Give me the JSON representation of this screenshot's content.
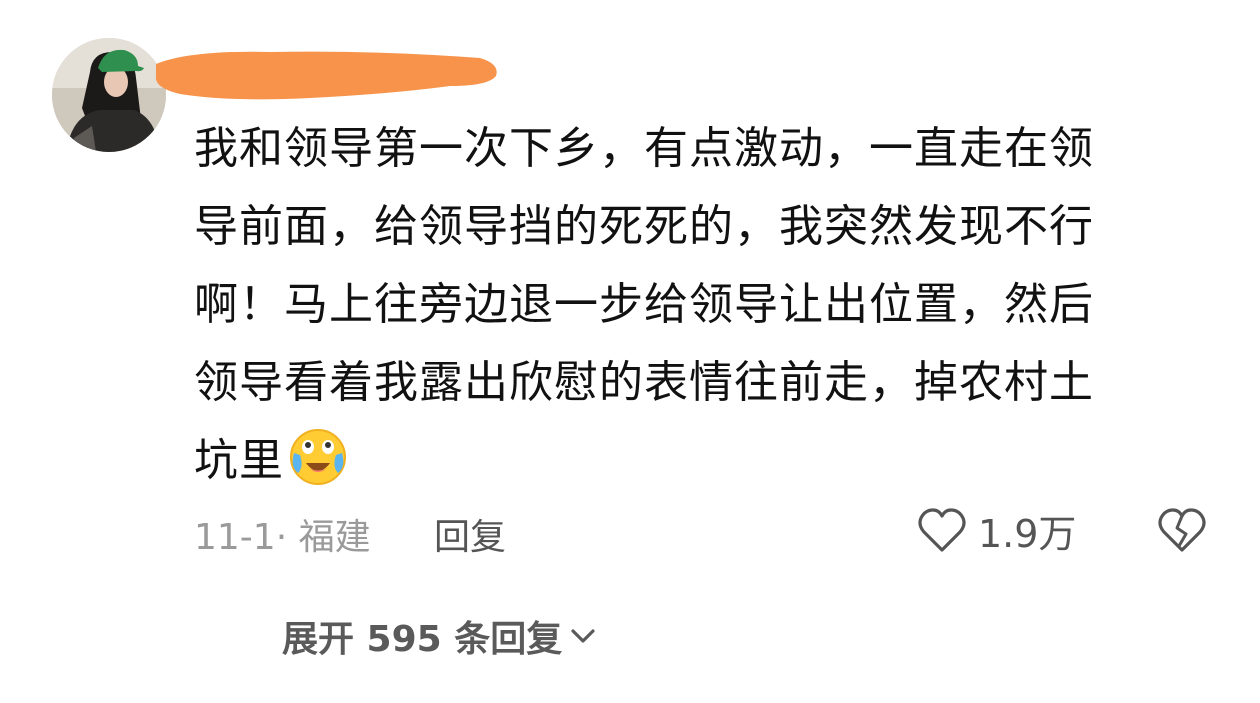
{
  "comment": {
    "avatar_icon": "user-avatar",
    "username_redaction_color": "#f7934a",
    "lines": [
      "我和领导第一次下乡，有点激动，一直走在领",
      "导前面，给领导挡的死死的，我突然发现不行",
      "啊！马上往旁边退一步给领导让出位置，然后",
      "领导看着我露出欣慰的表情往前走，掉农村土",
      "坑里"
    ],
    "emoji_icon": "laughing-crying-emoji",
    "date_location": "11-1· 福建",
    "reply_label": "回复",
    "like_icon": "heart-outline-icon",
    "like_count": "1.9万",
    "dislike_icon": "broken-heart-icon"
  },
  "replies": {
    "expand_label": "展开 595 条回复",
    "chevron_icon": "chevron-down-icon"
  }
}
